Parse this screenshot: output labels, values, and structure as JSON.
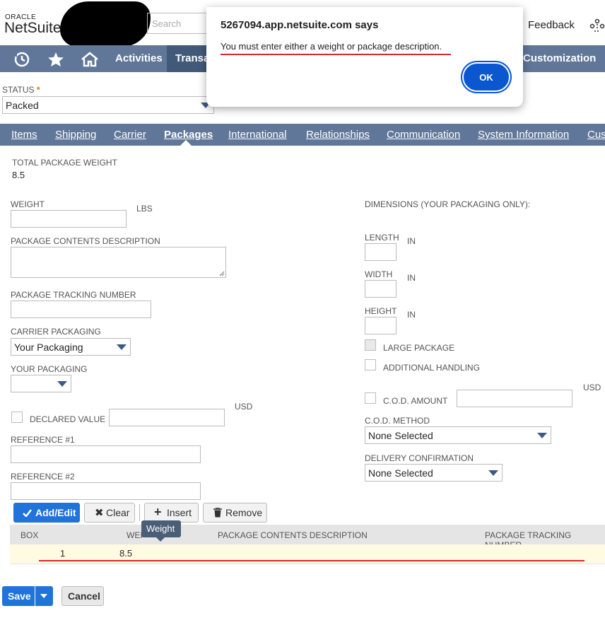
{
  "header": {
    "oracle": "ORACLE",
    "netsuite": "NetSuite",
    "search_placeholder": "Search",
    "feedback": "Feedback"
  },
  "nav": {
    "activities": "Activities",
    "transactions": "Transa",
    "customization": "Customization"
  },
  "status": {
    "label": "STATUS",
    "required_mark": "*",
    "value": "Packed"
  },
  "tabs": [
    "Items",
    "Shipping",
    "Carrier",
    "Packages",
    "International",
    "Relationships",
    "Communication",
    "System Information",
    "Cus"
  ],
  "packages": {
    "total_weight_label": "TOTAL PACKAGE WEIGHT",
    "total_weight_value": "8.5",
    "weight_label": "WEIGHT",
    "weight_unit": "LBS",
    "contents_label": "PACKAGE CONTENTS DESCRIPTION",
    "tracking_label": "PACKAGE TRACKING NUMBER",
    "carrier_packaging_label": "CARRIER PACKAGING",
    "carrier_packaging_value": "Your Packaging",
    "your_packaging_label": "YOUR PACKAGING",
    "declared_value_label": "DECLARED VALUE",
    "declared_currency": "USD",
    "ref1_label": "REFERENCE #1",
    "ref2_label": "REFERENCE #2",
    "dimensions_label": "DIMENSIONS (YOUR PACKAGING ONLY):",
    "length_label": "LENGTH",
    "width_label": "WIDTH",
    "height_label": "HEIGHT",
    "dim_unit": "IN",
    "large_package_label": "LARGE PACKAGE",
    "additional_handling_label": "ADDITIONAL HANDLING",
    "cod_amount_label": "C.O.D. AMOUNT",
    "cod_currency": "USD",
    "cod_method_label": "C.O.D. METHOD",
    "cod_method_value": "None Selected",
    "delivery_conf_label": "DELIVERY CONFIRMATION",
    "delivery_conf_value": "None Selected"
  },
  "buttons": {
    "add_edit": "Add/Edit",
    "clear": "Clear",
    "insert": "Insert",
    "remove": "Remove"
  },
  "grid": {
    "columns": [
      "BOX",
      "WEI",
      "PACKAGE CONTENTS DESCRIPTION",
      "PACKAGE TRACKING NUMBER"
    ],
    "rows": [
      {
        "box": "1",
        "weight": "8.5"
      }
    ]
  },
  "tooltip": "Weight",
  "dialog": {
    "title": "5267094.app.netsuite.com says",
    "message": "You must enter either a weight or package description.",
    "ok": "OK"
  },
  "footer": {
    "save": "Save",
    "cancel": "Cancel"
  },
  "colors": {
    "nav": "#607799",
    "primary": "#1f73d9",
    "error_underline": "#d42a2a"
  }
}
